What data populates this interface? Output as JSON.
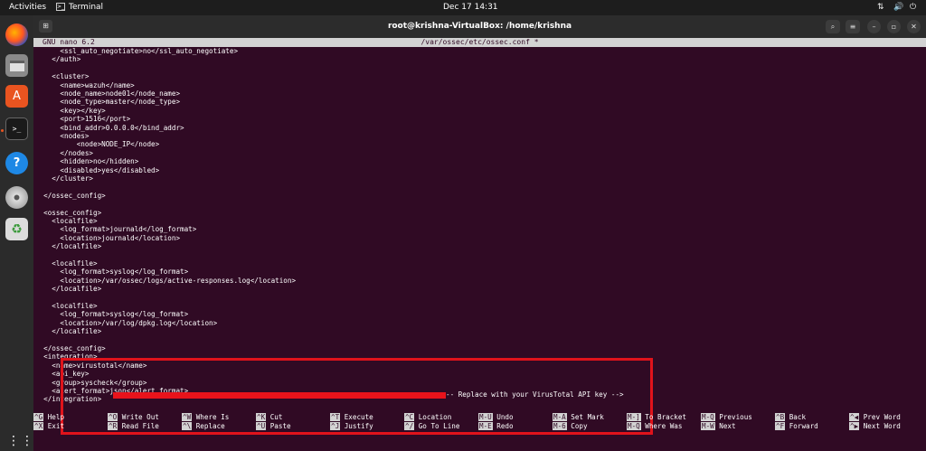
{
  "topbar": {
    "activities": "Activities",
    "app_name": "Terminal",
    "clock": "Dec 17  14:31",
    "icons": [
      "network-icon",
      "volume-icon",
      "power-icon"
    ]
  },
  "window": {
    "title": "root@krishna-VirtualBox: /home/krishna"
  },
  "nano": {
    "version": "GNU nano 6.2",
    "file": "/var/ossec/etc/ossec.conf *"
  },
  "editor": {
    "lines": [
      "      <ssl_auto_negotiate>no</ssl_auto_negotiate>",
      "    </auth>",
      "",
      "    <cluster>",
      "      <name>wazuh</name>",
      "      <node_name>node01</node_name>",
      "      <node_type>master</node_type>",
      "      <key></key>",
      "      <port>1516</port>",
      "      <bind_addr>0.0.0.0</bind_addr>",
      "      <nodes>",
      "          <node>NODE_IP</node>",
      "      </nodes>",
      "      <hidden>no</hidden>",
      "      <disabled>yes</disabled>",
      "    </cluster>",
      "",
      "  </ossec_config>",
      "",
      "  <ossec_config>",
      "    <localfile>",
      "      <log_format>journald</log_format>",
      "      <location>journald</location>",
      "    </localfile>",
      "",
      "    <localfile>",
      "      <log_format>syslog</log_format>",
      "      <location>/var/ossec/logs/active-responses.log</location>",
      "    </localfile>",
      "",
      "    <localfile>",
      "      <log_format>syslog</log_format>",
      "      <location>/var/log/dpkg.log</location>",
      "    </localfile>",
      "",
      "  </ossec_config>",
      "  <integration>",
      "    <name>virustotal</name>",
      "    <api_key>",
      "    <group>syscheck</group>",
      "    <alert_format>json</alert_format>",
      "  </integration>"
    ],
    "api_key_tail": "-- Replace with your VirusTotal API key -->"
  },
  "shortcuts": [
    {
      "k1": "^G",
      "l1": "Help",
      "k2": "^X",
      "l2": "Exit"
    },
    {
      "k1": "^O",
      "l1": "Write Out",
      "k2": "^R",
      "l2": "Read File"
    },
    {
      "k1": "^W",
      "l1": "Where Is",
      "k2": "^\\",
      "l2": "Replace"
    },
    {
      "k1": "^K",
      "l1": "Cut",
      "k2": "^U",
      "l2": "Paste"
    },
    {
      "k1": "^T",
      "l1": "Execute",
      "k2": "^J",
      "l2": "Justify"
    },
    {
      "k1": "^C",
      "l1": "Location",
      "k2": "^/",
      "l2": "Go To Line"
    },
    {
      "k1": "M-U",
      "l1": "Undo",
      "k2": "M-E",
      "l2": "Redo"
    },
    {
      "k1": "M-A",
      "l1": "Set Mark",
      "k2": "M-6",
      "l2": "Copy"
    },
    {
      "k1": "M-]",
      "l1": "To Bracket",
      "k2": "M-Q",
      "l2": "Where Was"
    },
    {
      "k1": "M-Q",
      "l1": "Previous",
      "k2": "M-W",
      "l2": "Next"
    },
    {
      "k1": "^B",
      "l1": "Back",
      "k2": "^F",
      "l2": "Forward"
    },
    {
      "k1": "^◀",
      "l1": "Prev Word",
      "k2": "^▶",
      "l2": "Next Word"
    }
  ],
  "colors": {
    "terminal_bg": "#300a24",
    "highlight": "#e0131b",
    "ubuntu_orange": "#e95420"
  }
}
